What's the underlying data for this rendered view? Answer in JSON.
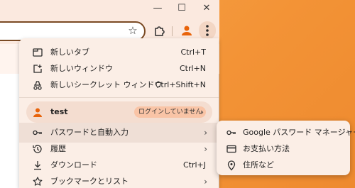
{
  "window": {
    "minimize_glyph": "—",
    "maximize_glyph": "☐",
    "close_glyph": "✕"
  },
  "toolbar": {
    "star_icon": "star-icon",
    "extensions_icon": "puzzle-icon",
    "profile_icon": "person-icon",
    "menu_icon": "kebab-menu-icon"
  },
  "menu": {
    "items_top": [
      {
        "label": "新しいタブ",
        "shortcut": "Ctrl+T",
        "icon": "new-tab-icon"
      },
      {
        "label": "新しいウィンドウ",
        "shortcut": "Ctrl+N",
        "icon": "new-window-icon"
      },
      {
        "label": "新しいシークレット ウィンドウ",
        "shortcut": "Ctrl+Shift+N",
        "icon": "incognito-icon"
      }
    ],
    "profile": {
      "name": "test",
      "status": "ログインしていません"
    },
    "items_bottom": [
      {
        "label": "パスワードと自動入力",
        "icon": "key-icon"
      },
      {
        "label": "履歴",
        "icon": "history-icon"
      },
      {
        "label": "ダウンロード",
        "shortcut": "Ctrl+J",
        "icon": "download-icon"
      },
      {
        "label": "ブックマークとリスト",
        "icon": "bookmark-star-icon"
      }
    ],
    "chevron": "›"
  },
  "submenu": {
    "items": [
      {
        "label": "Google パスワード マネージャー",
        "icon": "key-icon"
      },
      {
        "label": "お支払い方法",
        "icon": "credit-card-icon"
      },
      {
        "label": "住所など",
        "icon": "location-pin-icon"
      }
    ]
  },
  "colors": {
    "accent": "#e8630a",
    "menu_bg": "#fbeee6",
    "desktop": "#f39336"
  }
}
